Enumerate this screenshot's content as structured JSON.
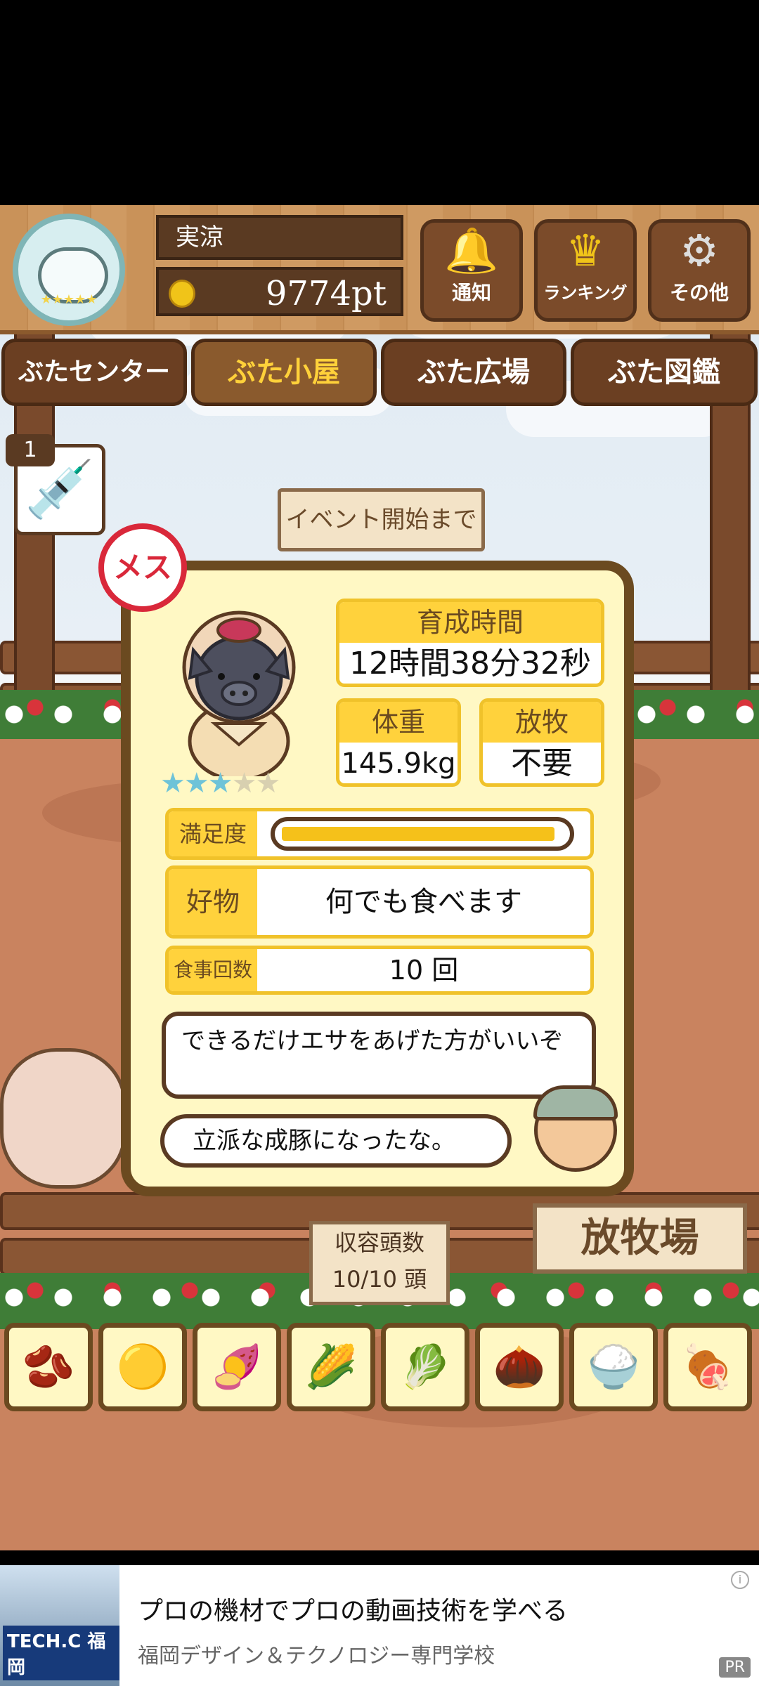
{
  "header": {
    "username": "実涼",
    "points": "9774pt",
    "buttons": [
      {
        "label": "通知",
        "icon": "bell-icon"
      },
      {
        "label": "ランキング",
        "icon": "crown-icon"
      },
      {
        "label": "その他",
        "icon": "gear-icon"
      }
    ]
  },
  "nav": {
    "tabs": [
      {
        "label": "ぶたセンター"
      },
      {
        "label": "ぶた小屋",
        "active": true
      },
      {
        "label": "ぶた広場"
      },
      {
        "label": "ぶた図鑑"
      }
    ]
  },
  "syringe_count": "1",
  "event_sign": "イベント開始まで",
  "pig": {
    "gender": "メス",
    "rating": 3,
    "rating_max": 5,
    "raising_time_label": "育成時間",
    "raising_time": "12時間38分32秒",
    "weight_label": "体重",
    "weight": "145.9kg",
    "grazing_label": "放牧",
    "grazing": "不要",
    "satisfaction_label": "満足度",
    "satisfaction": 0.97,
    "favorite_label": "好物",
    "favorite": "何でも食べます",
    "meals_label": "食事回数",
    "meals": "10 回"
  },
  "speech": {
    "advice": "できるだけエサをあげた方がいいぞ",
    "comment": "立派な成豚になったな。"
  },
  "capacity": {
    "label": "収容頭数",
    "value": "10/10 頭"
  },
  "ranch_sign": "放牧場",
  "foods": [
    "soybeans-icon",
    "mixed-beans-icon",
    "sweet-potato-icon",
    "corn-icon",
    "vegetables-icon",
    "acorns-icon",
    "grain-dish-icon",
    "meat-dish-icon"
  ],
  "ad": {
    "title": "プロの機材でプロの動画技術を学べる",
    "subtitle": "福岡デザイン＆テクノロジー専門学校",
    "image_label": "TECH.C 福岡",
    "badge": "PR"
  }
}
